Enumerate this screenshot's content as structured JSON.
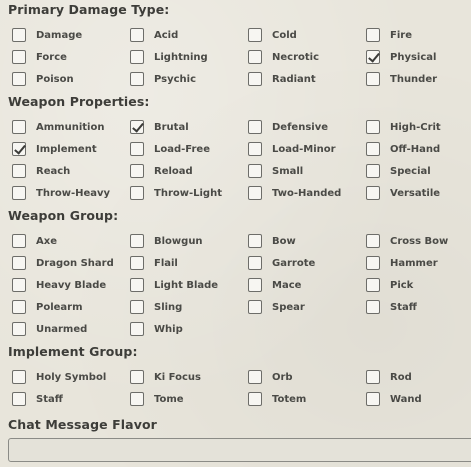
{
  "sections": {
    "primary_damage_type": {
      "title": "Primary Damage Type:",
      "rows": [
        [
          {
            "label": "Damage",
            "checked": false
          },
          {
            "label": "Acid",
            "checked": false
          },
          {
            "label": "Cold",
            "checked": false
          },
          {
            "label": "Fire",
            "checked": false
          }
        ],
        [
          {
            "label": "Force",
            "checked": false
          },
          {
            "label": "Lightning",
            "checked": false
          },
          {
            "label": "Necrotic",
            "checked": false
          },
          {
            "label": "Physical",
            "checked": true
          }
        ],
        [
          {
            "label": "Poison",
            "checked": false
          },
          {
            "label": "Psychic",
            "checked": false
          },
          {
            "label": "Radiant",
            "checked": false
          },
          {
            "label": "Thunder",
            "checked": false
          }
        ]
      ]
    },
    "weapon_properties": {
      "title": "Weapon Properties:",
      "rows": [
        [
          {
            "label": "Ammunition",
            "checked": false
          },
          {
            "label": "Brutal",
            "checked": true
          },
          {
            "label": "Defensive",
            "checked": false
          },
          {
            "label": "High-Crit",
            "checked": false
          }
        ],
        [
          {
            "label": "Implement",
            "checked": true
          },
          {
            "label": "Load-Free",
            "checked": false
          },
          {
            "label": "Load-Minor",
            "checked": false
          },
          {
            "label": "Off-Hand",
            "checked": false
          }
        ],
        [
          {
            "label": "Reach",
            "checked": false
          },
          {
            "label": "Reload",
            "checked": false
          },
          {
            "label": "Small",
            "checked": false
          },
          {
            "label": "Special",
            "checked": false
          }
        ],
        [
          {
            "label": "Throw-Heavy",
            "checked": false
          },
          {
            "label": "Throw-Light",
            "checked": false
          },
          {
            "label": "Two-Handed",
            "checked": false
          },
          {
            "label": "Versatile",
            "checked": false
          }
        ]
      ]
    },
    "weapon_group": {
      "title": "Weapon Group:",
      "rows": [
        [
          {
            "label": "Axe",
            "checked": false
          },
          {
            "label": "Blowgun",
            "checked": false
          },
          {
            "label": "Bow",
            "checked": false
          },
          {
            "label": "Cross Bow",
            "checked": false
          }
        ],
        [
          {
            "label": "Dragon Shard",
            "checked": false
          },
          {
            "label": "Flail",
            "checked": false
          },
          {
            "label": "Garrote",
            "checked": false
          },
          {
            "label": "Hammer",
            "checked": false
          }
        ],
        [
          {
            "label": "Heavy Blade",
            "checked": false
          },
          {
            "label": "Light Blade",
            "checked": false
          },
          {
            "label": "Mace",
            "checked": false
          },
          {
            "label": "Pick",
            "checked": false
          }
        ],
        [
          {
            "label": "Polearm",
            "checked": false
          },
          {
            "label": "Sling",
            "checked": false
          },
          {
            "label": "Spear",
            "checked": false
          },
          {
            "label": "Staff",
            "checked": false
          }
        ],
        [
          {
            "label": "Unarmed",
            "checked": false
          },
          {
            "label": "Whip",
            "checked": false
          }
        ]
      ]
    },
    "implement_group": {
      "title": "Implement Group:",
      "rows": [
        [
          {
            "label": "Holy Symbol",
            "checked": false
          },
          {
            "label": "Ki Focus",
            "checked": false
          },
          {
            "label": "Orb",
            "checked": false
          },
          {
            "label": "Rod",
            "checked": false
          }
        ],
        [
          {
            "label": "Staff",
            "checked": false
          },
          {
            "label": "Tome",
            "checked": false
          },
          {
            "label": "Totem",
            "checked": false
          },
          {
            "label": "Wand",
            "checked": false
          }
        ]
      ]
    },
    "chat_message_flavor": {
      "title": "Chat Message Flavor",
      "value": ""
    }
  }
}
